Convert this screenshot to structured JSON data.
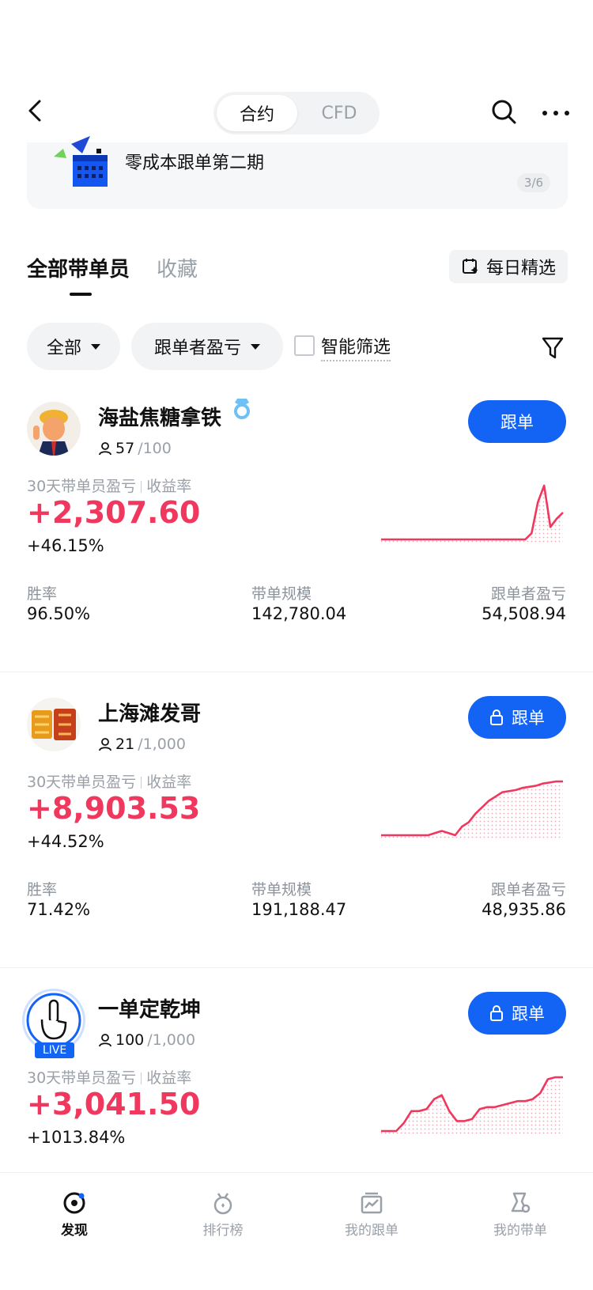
{
  "header": {
    "segments": [
      "合约",
      "CFD"
    ]
  },
  "banner": {
    "title": "零成本跟单第二期",
    "page": "3/6"
  },
  "tabs": {
    "all": "全部带单员",
    "favorites": "收藏",
    "daily_pick": "每日精选"
  },
  "filters": {
    "scope": "全部",
    "follower_pnl": "跟单者盈亏",
    "smart_filter": "智能筛选"
  },
  "labels": {
    "pnl_30d": "30天带单员盈亏",
    "return_rate": "收益率",
    "win_rate": "胜率",
    "scale": "带单规模",
    "follower_pnl": "跟单者盈亏",
    "follow": "跟单",
    "live": "LIVE"
  },
  "traders": [
    {
      "name": "海盐焦糖拿铁",
      "followers": "57",
      "capacity": "/100",
      "pnl": "+2,307.60",
      "rate": "+46.15%",
      "win_rate": "96.50%",
      "scale": "142,780.04",
      "follower_pnl": "54,508.94",
      "locked": false,
      "trend": [
        0,
        0,
        0,
        0,
        0,
        0,
        0,
        0,
        0,
        0,
        0,
        0,
        0,
        0,
        0,
        0,
        0,
        0,
        0,
        0,
        0,
        0,
        0,
        0,
        0.3,
        1.8,
        2.6,
        0.6,
        1.0,
        1.3
      ]
    },
    {
      "name": "上海滩发哥",
      "followers": "21",
      "capacity": "/1,000",
      "pnl": "+8,903.53",
      "rate": "+44.52%",
      "win_rate": "71.42%",
      "scale": "191,188.47",
      "follower_pnl": "48,935.86",
      "locked": true,
      "trend": [
        0,
        0,
        0,
        0,
        0,
        0,
        0,
        0,
        0.1,
        0.2,
        0.1,
        0,
        0.4,
        0.6,
        1.0,
        1.3,
        1.6,
        1.8,
        2.0,
        2.05,
        2.1,
        2.2,
        2.25,
        2.3,
        2.4,
        2.45,
        2.5,
        2.5
      ]
    },
    {
      "name": "一单定乾坤",
      "followers": "100",
      "capacity": "/1,000",
      "pnl": "+3,041.50",
      "rate": "+1013.84%",
      "locked": true,
      "live": true,
      "trend": [
        0,
        0,
        0,
        0.4,
        1.0,
        1.0,
        1.1,
        1.6,
        1.8,
        1.0,
        0.5,
        0.5,
        0.6,
        1.1,
        1.2,
        1.2,
        1.3,
        1.4,
        1.5,
        1.5,
        1.6,
        1.9,
        2.6,
        2.7,
        2.7
      ]
    }
  ],
  "bottom_nav": [
    {
      "label": "发现",
      "icon": "discover-icon",
      "active": true
    },
    {
      "label": "排行榜",
      "icon": "ranking-icon",
      "active": false
    },
    {
      "label": "我的跟单",
      "icon": "my-copy-icon",
      "active": false
    },
    {
      "label": "我的带单",
      "icon": "my-lead-icon",
      "active": false
    }
  ]
}
